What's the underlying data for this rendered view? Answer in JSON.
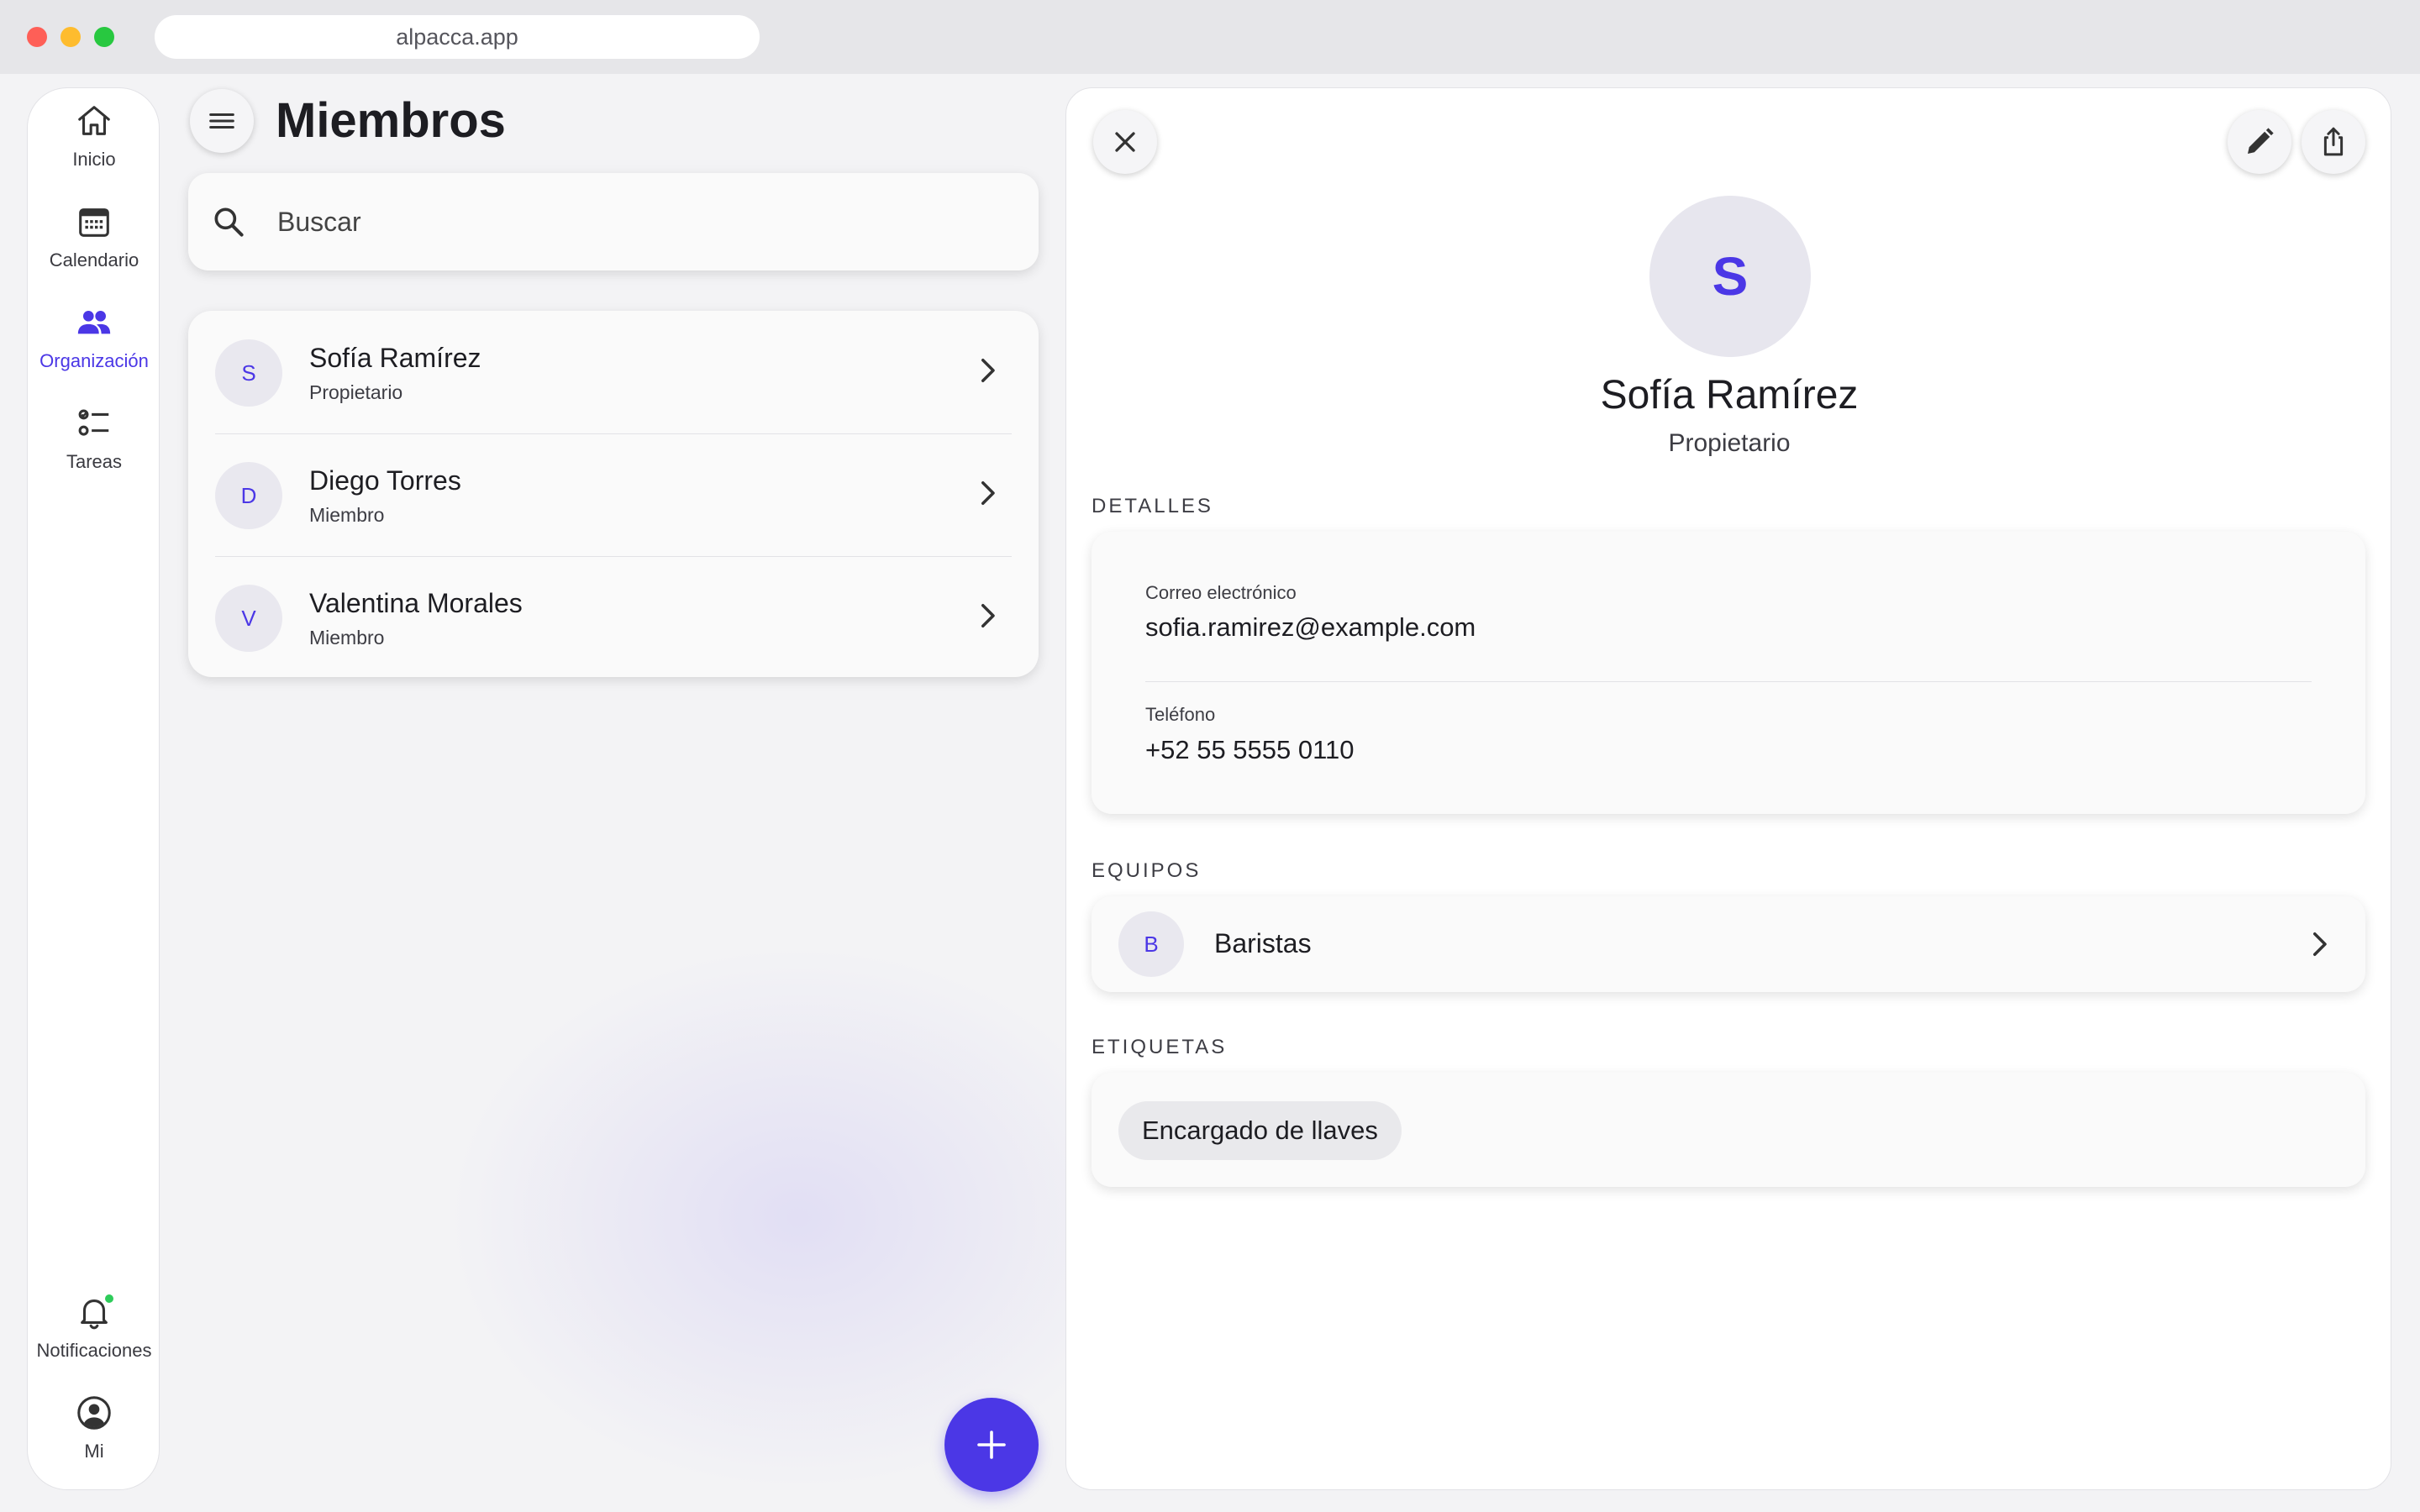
{
  "browser": {
    "url": "alpacca.app"
  },
  "sidebar": {
    "items": [
      {
        "label": "Inicio",
        "icon": "home-icon"
      },
      {
        "label": "Calendario",
        "icon": "calendar-icon"
      },
      {
        "label": "Organización",
        "icon": "people-icon",
        "active": true
      },
      {
        "label": "Tareas",
        "icon": "tasks-icon"
      }
    ],
    "bottom_items": [
      {
        "label": "Notificaciones",
        "icon": "bell-icon",
        "has_unread": true
      },
      {
        "label": "Mi",
        "icon": "account-circle-icon"
      }
    ]
  },
  "members_panel": {
    "title": "Miembros",
    "search_placeholder": "Buscar",
    "members": [
      {
        "initial": "S",
        "name": "Sofía Ramírez",
        "role": "Propietario"
      },
      {
        "initial": "D",
        "name": "Diego Torres",
        "role": "Miembro"
      },
      {
        "initial": "V",
        "name": "Valentina Morales",
        "role": "Miembro"
      }
    ]
  },
  "detail": {
    "initial": "S",
    "name": "Sofía Ramírez",
    "role": "Propietario",
    "details_label": "DETALLES",
    "email_label": "Correo electrónico",
    "email": "sofia.ramirez@example.com",
    "phone_label": "Teléfono",
    "phone": "+52 55 5555 0110",
    "teams_label": "EQUIPOS",
    "teams": [
      {
        "initial": "B",
        "name": "Baristas"
      }
    ],
    "tags_label": "ETIQUETAS",
    "tags": [
      "Encargado de llaves"
    ]
  },
  "colors": {
    "accent": "#4b37e6",
    "notification_dot": "#2ecc5a",
    "avatar_bg": "#e9e8ef"
  }
}
